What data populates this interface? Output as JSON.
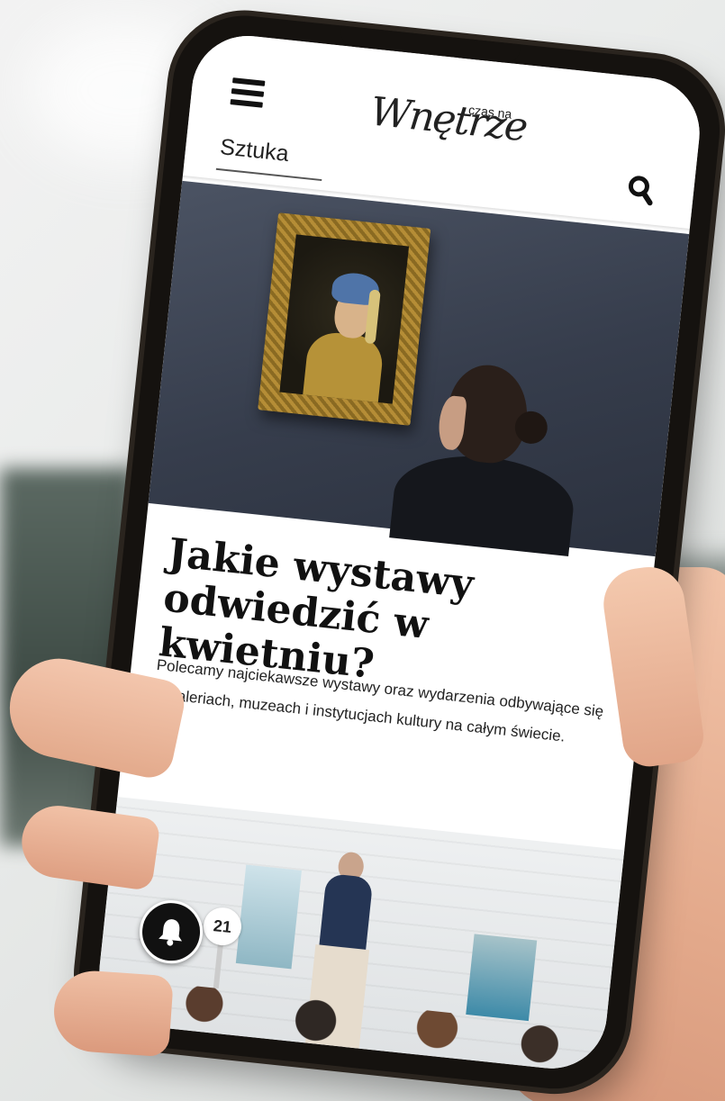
{
  "header": {
    "logo_small": "czas na",
    "logo_script": "Wnętrze",
    "category": "Sztuka"
  },
  "article": {
    "title": "Jakie wystawy odwiedzić w kwietniu?",
    "excerpt": "Polecamy najciekawsze wystawy oraz wydarzenia odbywające się w galeriach, muzeach i instytucjach kultury na całym świecie."
  },
  "second_article": {
    "paddle_number": "21"
  },
  "icons": {
    "menu": "hamburger-menu-icon",
    "search": "search-icon",
    "notification": "bell-icon"
  },
  "colors": {
    "text": "#111111",
    "background": "#ffffff",
    "bell_button": "#111111"
  }
}
